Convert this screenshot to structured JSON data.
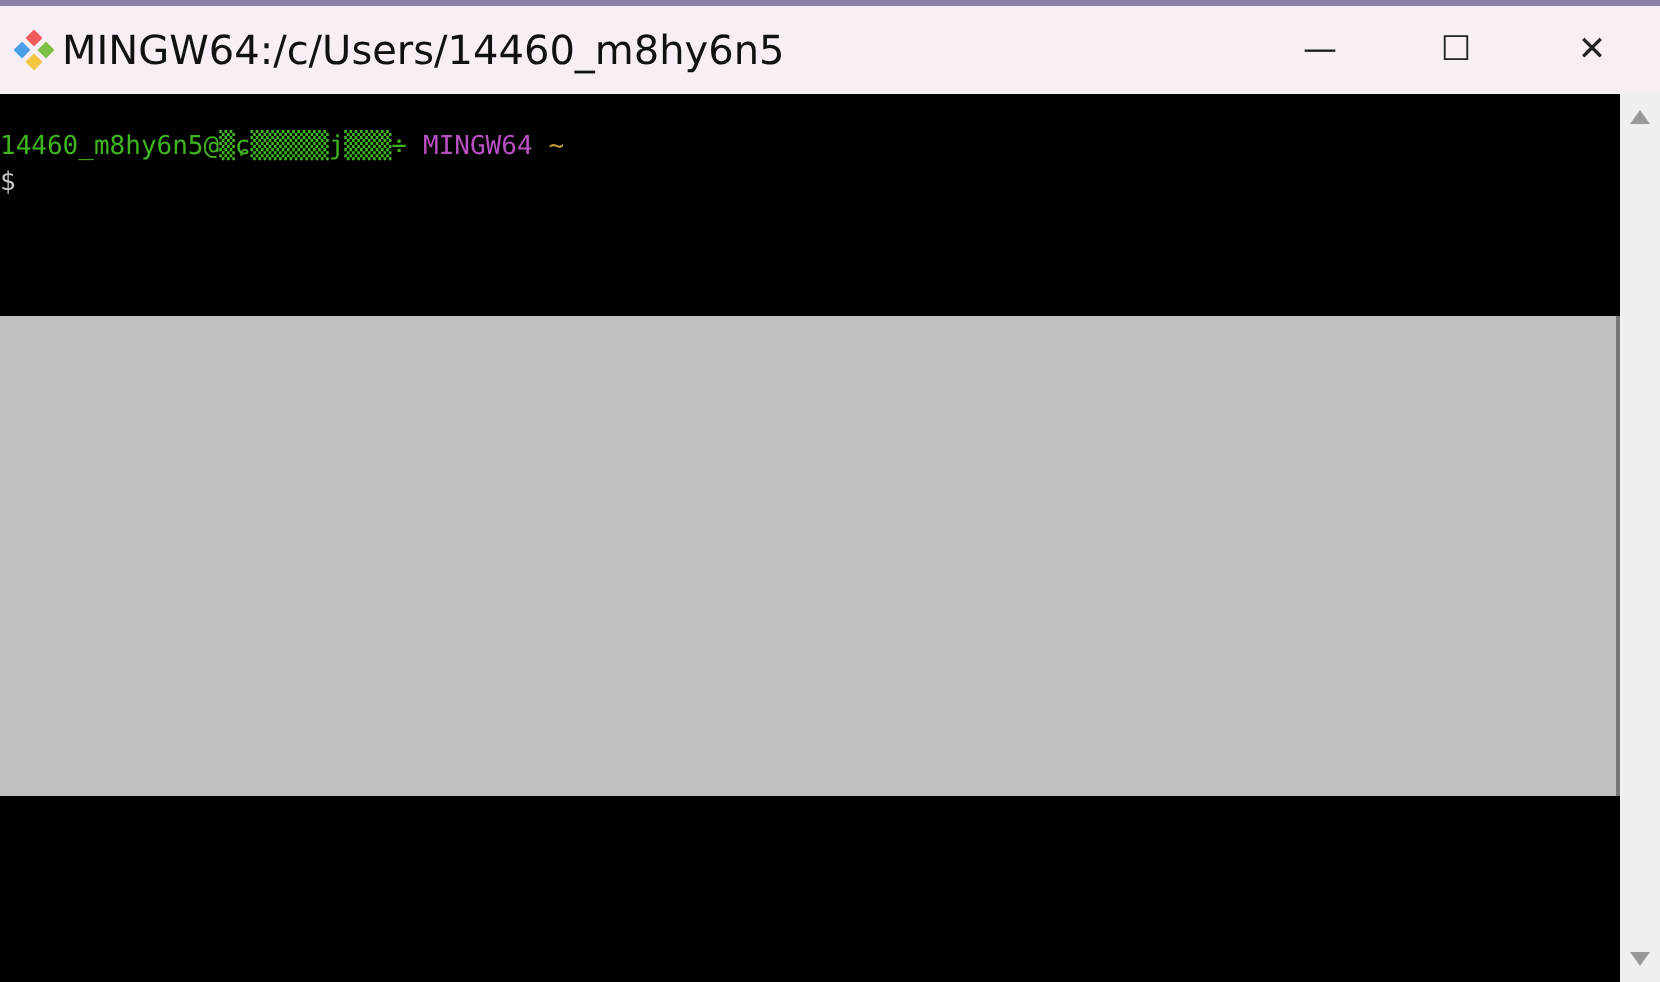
{
  "window": {
    "title": "MINGW64:/c/Users/14460_m8hy6n5",
    "controls": [
      "—",
      "☐",
      "✕"
    ]
  },
  "terminal": {
    "lines": [
      {
        "segments": [
          {
            "text": "14460_m8hy6n5@▒ɕ▒▒▒▒▒j▒▒▒÷",
            "color": "#3fb51f"
          },
          {
            "text": "MINGW64",
            "color": "#b84fc2"
          },
          {
            "text": "~",
            "color": "#c0a030"
          }
        ]
      },
      {
        "segments": [
          {
            "text": "$",
            "color": "#c8c8c8"
          }
        ]
      }
    ]
  }
}
